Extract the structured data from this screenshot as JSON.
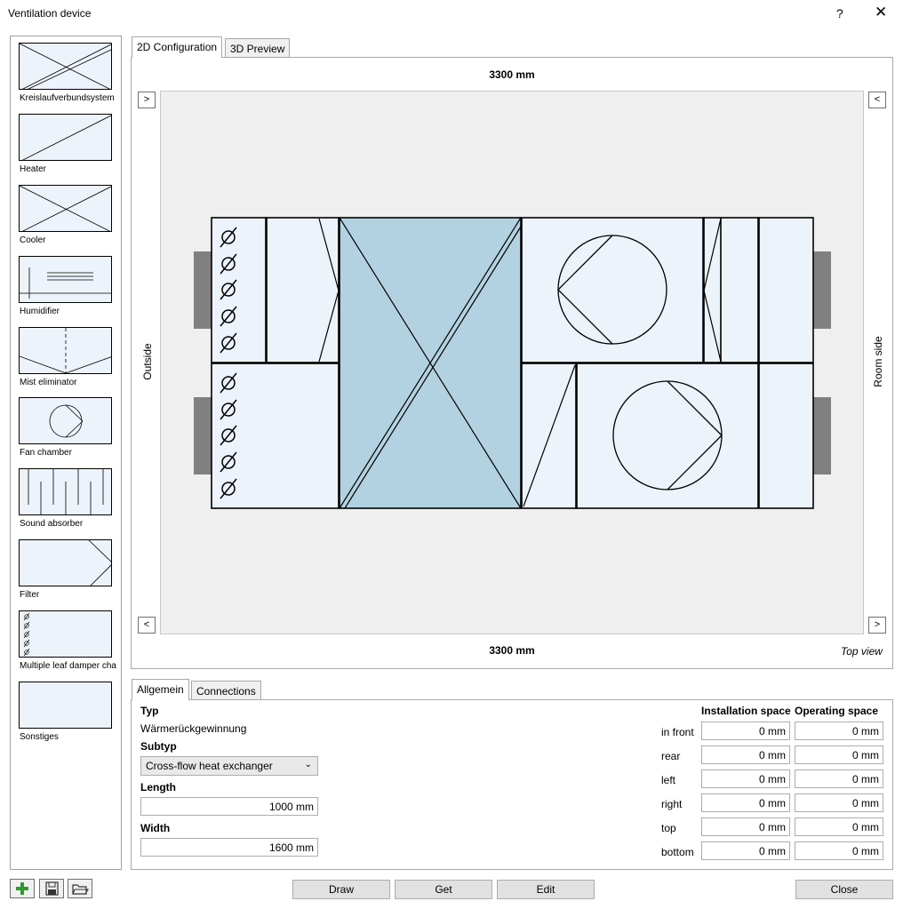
{
  "window": {
    "title": "Ventilation device",
    "help": "?",
    "close": "✕"
  },
  "palette": [
    {
      "label": "Kreislaufverbundsystem",
      "icon": "heat-recovery-icon"
    },
    {
      "label": "Heater",
      "icon": "heater-icon"
    },
    {
      "label": "Cooler",
      "icon": "cooler-icon"
    },
    {
      "label": "Humidifier",
      "icon": "humidifier-icon"
    },
    {
      "label": "Mist eliminator",
      "icon": "mist-eliminator-icon"
    },
    {
      "label": "Fan chamber",
      "icon": "fan-chamber-icon"
    },
    {
      "label": "Sound absorber",
      "icon": "sound-absorber-icon"
    },
    {
      "label": "Filter",
      "icon": "filter-icon"
    },
    {
      "label": "Multiple leaf damper cha",
      "icon": "damper-icon"
    },
    {
      "label": "Sonstiges",
      "icon": "other-icon"
    }
  ],
  "tabs": {
    "config": "2D Configuration",
    "preview": "3D Preview"
  },
  "canvas": {
    "top_dim": "3300 mm",
    "bottom_dim": "3300 mm",
    "outside_label": "Outside",
    "room_label": "Room side",
    "view_label": "Top view",
    "btn_top_left": ">",
    "btn_top_right": "<",
    "btn_bottom_left": "<",
    "btn_bottom_right": ">"
  },
  "props_tabs": {
    "general": "Allgemein",
    "connections": "Connections"
  },
  "props": {
    "typ_label": "Typ",
    "typ_value": "Wärmerückgewinnung",
    "subtyp_label": "Subtyp",
    "subtyp_value": "Cross-flow heat exchanger",
    "length_label": "Length",
    "length_value": "1000 mm",
    "width_label": "Width",
    "width_value": "1600 mm"
  },
  "space": {
    "col_install": "Installation space",
    "col_operating": "Operating space",
    "rows": [
      {
        "label": "in front",
        "install": "0 mm",
        "operating": "0 mm"
      },
      {
        "label": "rear",
        "install": "0 mm",
        "operating": "0 mm"
      },
      {
        "label": "left",
        "install": "0 mm",
        "operating": "0 mm"
      },
      {
        "label": "right",
        "install": "0 mm",
        "operating": "0 mm"
      },
      {
        "label": "top",
        "install": "0 mm",
        "operating": "0 mm"
      },
      {
        "label": "bottom",
        "install": "0 mm",
        "operating": "0 mm"
      }
    ]
  },
  "buttons": {
    "draw": "Draw",
    "get": "Get",
    "edit": "Edit",
    "close": "Close"
  },
  "colors": {
    "panel_fill": "#edf3fa",
    "exchanger_fill": "#b3d2e1",
    "connector": "#808080",
    "add_green": "#2e9a2e"
  }
}
